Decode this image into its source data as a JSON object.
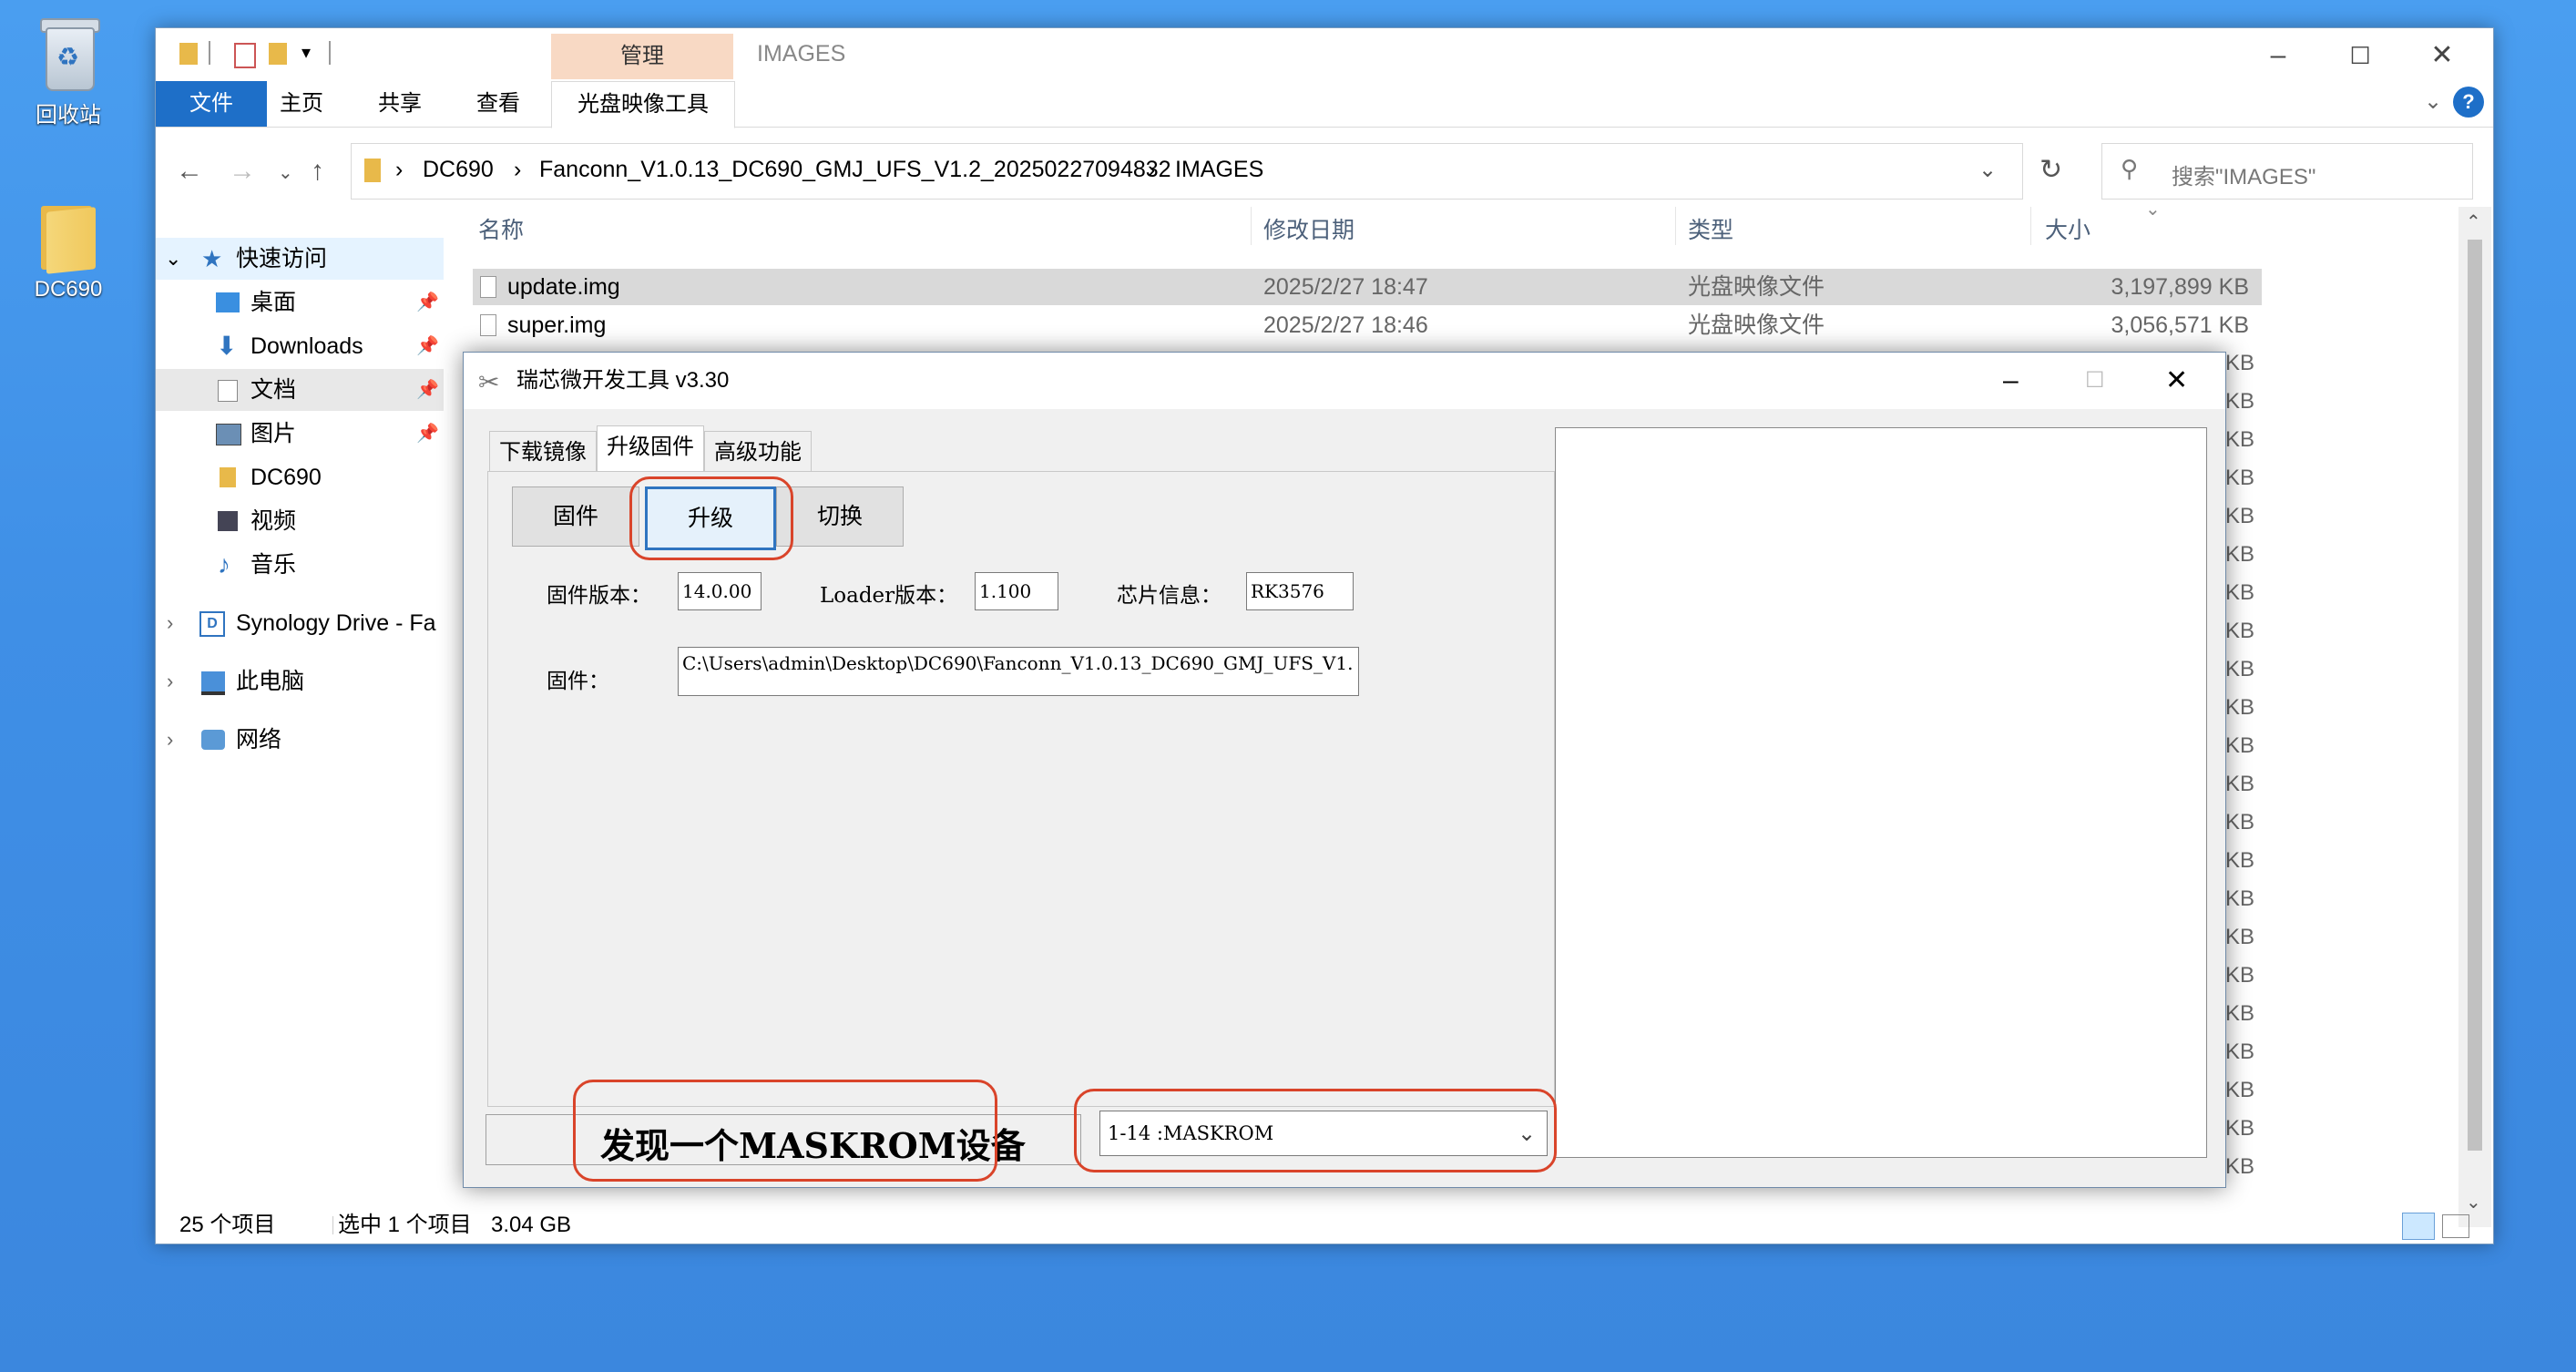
{
  "desktop": {
    "recycle_bin": "回收站",
    "folder": "DC690"
  },
  "explorer": {
    "context_tab_header": "管理",
    "window_title": "IMAGES",
    "ribbon_tabs": [
      "文件",
      "主页",
      "共享",
      "查看",
      "光盘映像工具"
    ],
    "breadcrumb": [
      "DC690",
      "Fanconn_V1.0.13_DC690_GMJ_UFS_V1.2_20250227094832",
      "IMAGES"
    ],
    "search_placeholder": "搜索\"IMAGES\"",
    "nav": {
      "quick_access": "快速访问",
      "items": [
        "桌面",
        "Downloads",
        "文档",
        "图片",
        "DC690",
        "视频",
        "音乐"
      ],
      "synology": "Synology Drive - Fa",
      "this_pc": "此电脑",
      "network": "网络"
    },
    "columns": {
      "name": "名称",
      "modified": "修改日期",
      "type": "类型",
      "size": "大小"
    },
    "files": [
      {
        "name": "update.img",
        "modified": "2025/2/27 18:47",
        "type": "光盘映像文件",
        "size": "3,197,899 KB"
      },
      {
        "name": "super.img",
        "modified": "2025/2/27 18:46",
        "type": "光盘映像文件",
        "size": "3,056,571 KB"
      }
    ],
    "kb_suffix": "KB",
    "status": {
      "count": "25 个项目",
      "selected": "选中 1 个项目",
      "size": "3.04 GB"
    }
  },
  "rk_tool": {
    "title": "瑞芯微开发工具 v3.30",
    "tabs": [
      "下载镜像",
      "升级固件",
      "高级功能"
    ],
    "buttons": {
      "firmware": "固件",
      "upgrade": "升级",
      "switch": "切换"
    },
    "fw_version_label": "固件版本：",
    "fw_version": "14.0.00",
    "loader_label": "Loader版本：",
    "loader_version": "1.100",
    "chip_label": "芯片信息：",
    "chip_info": "RK3576",
    "firmware_label": "固件：",
    "firmware_path": "C:\\Users\\admin\\Desktop\\DC690\\Fanconn_V1.0.13_DC690_GMJ_UFS_V1.",
    "status_message": "发现一个MASKROM设备",
    "device_select": "1-14 :MASKROM"
  },
  "colors": {
    "accent": "#1e6fc8",
    "highlight": "#d9442a",
    "selection": "#cce8ff"
  }
}
